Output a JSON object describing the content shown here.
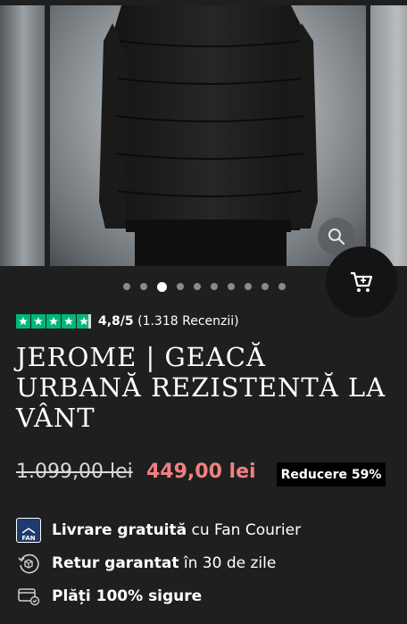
{
  "gallery": {
    "dots_count": 10,
    "active_dot": 2,
    "zoom_icon": "magnifier-icon",
    "cart_icon": "cart-add-icon"
  },
  "rating": {
    "stars": 4.8,
    "score": "4,8/5",
    "reviews": "(1.318 Recenzii)",
    "star_color": "#00b67a"
  },
  "product": {
    "title": "JEROME | GEACĂ URBANĂ REZISTENTĂ LA VÂNT",
    "old_price": "1.099,00 lei",
    "new_price": "449,00 lei",
    "discount": "Reducere 59%",
    "price_color": "#f08080"
  },
  "features": [
    {
      "icon": "fan-courier-logo",
      "logo_text": "FAN",
      "bold": "Livrare gratuită",
      "rest": " cu Fan Courier"
    },
    {
      "icon": "return-box-icon",
      "bold": "Retur garantat",
      "rest": " în 30 de zile"
    },
    {
      "icon": "secure-card-icon",
      "bold": "Plăți 100% sigure",
      "rest": ""
    }
  ]
}
